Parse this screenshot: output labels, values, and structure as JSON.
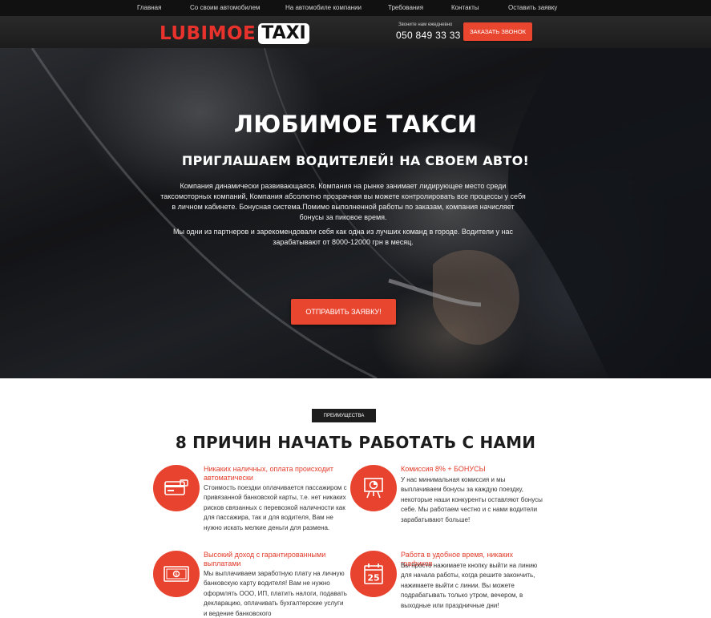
{
  "nav": {
    "items": [
      {
        "label": "Главная"
      },
      {
        "label": "Со своим автомобилем"
      },
      {
        "label": "На автомобиле компании"
      },
      {
        "label": "Требования"
      },
      {
        "label": "Контакты"
      },
      {
        "label": "Оставить заявку"
      }
    ]
  },
  "header": {
    "logo_part1": "LUBIMOE",
    "logo_part2": "TAXI",
    "phone_hint": "Звоните нам ежедневно",
    "phone": "050 849 33 33",
    "call_button": "ЗАКАЗАТЬ ЗВОНОК"
  },
  "hero": {
    "title": "ЛЮБИМОЕ ТАКСИ",
    "subtitle": "ПРИГЛАШАЕМ ВОДИТЕЛЕЙ! НА СВОЕМ АВТО!",
    "paragraph1": "Компания динамически развивающаяся. Компания на рынке занимает лидирующее место среди таксомоторных компаний, Компания абсолютно прозрачная вы можете контролировать все процессы у себя в личном кабинете. Бонусная система.Помимо выполненной работы по заказам, компания начисляет бонусы за пиковое время.",
    "paragraph2": "Мы одни из партнеров и зарекомендовали себя как одна из лучших команд в городе. Водители у нас зарабатывают от 8000-12000 грн в месяц.",
    "apply_button": "ОТПРАВИТЬ ЗАЯВКУ!"
  },
  "advantages": {
    "badge": "ПРЕИМУЩЕСТВА",
    "title": "8 ПРИЧИН НАЧАТЬ РАБОТАТЬ С НАМИ",
    "items": [
      {
        "icon": "credit-card-icon",
        "title": "Никаких наличных, оплата происходит автоматически",
        "text": "Стоимость поездки оплачивается пассажиром с привязанной банковской карты, т.е. нет никаких рисков связанных с перевозкой наличности как для пассажира, так и для водителя, Вам не нужно искать мелкие деньги для размена."
      },
      {
        "icon": "presentation-chart-icon",
        "title": "Комиссия 8% + БОНУСЫ",
        "text": "У нас минимальная комиссия и мы выплачиваем бонусы за каждую поездку, некоторые наши конкуренты оставляют бонусы себе. Мы работаем честно и с нами водители зарабатывают больше!"
      },
      {
        "icon": "banknote-icon",
        "title": "Высокий доход с гарантированными выплатами",
        "text": "Мы выплачиваем заработную плату на личную банковскую карту водителя! Вам не нужно оформлять ООО, ИП, платить налоги, подавать декларацию, оплачивать бухгалтерские услуги и ведение банковского"
      },
      {
        "icon": "calendar-icon",
        "calendar_day": "25",
        "title": "Работа в удобное время, никаких графиков",
        "text": "Вы просто нажимаете кнопку выйти на линию для начала работы, когда решите закончить, нажимаете выйти с линии. Вы можете подрабатывать только утром, вечером, в выходные или праздничные дни!"
      }
    ]
  },
  "colors": {
    "accent": "#e8462f",
    "nav_bg": "#111111",
    "text_dark": "#1c1c1c"
  }
}
